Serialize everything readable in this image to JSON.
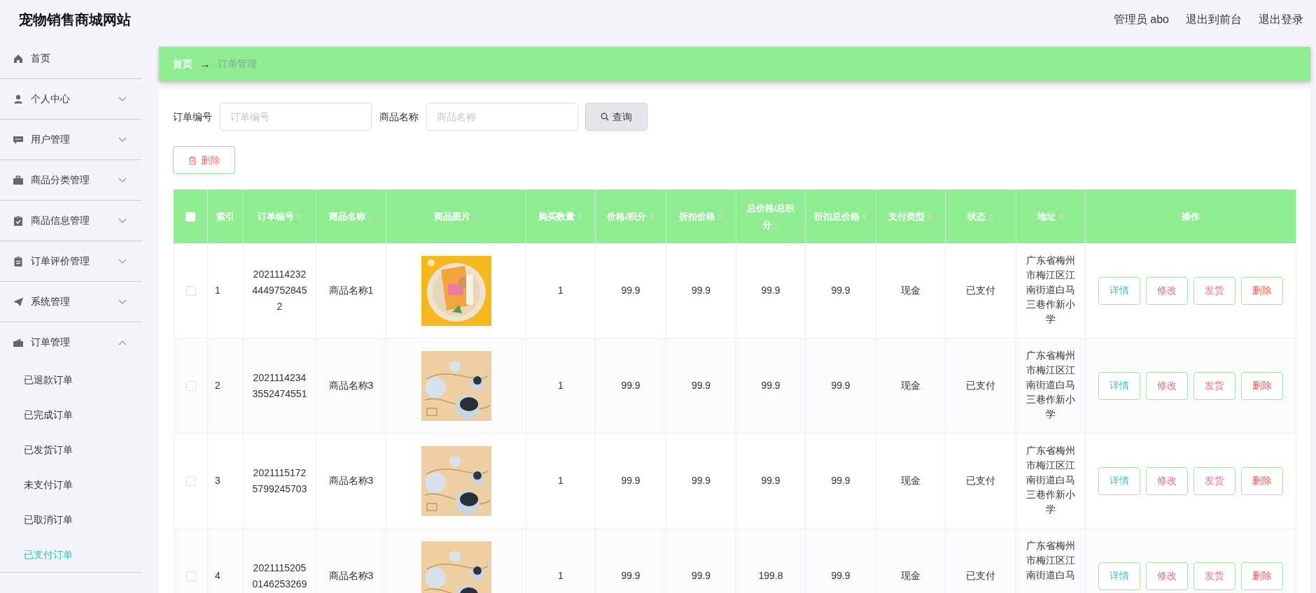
{
  "header": {
    "title": "宠物销售商城网站",
    "links": [
      "管理员 abo",
      "退出到前台",
      "退出登录"
    ]
  },
  "sidebar": {
    "items": [
      {
        "label": "首页",
        "kind": "link"
      },
      {
        "label": "个人中心",
        "kind": "submenu",
        "expanded": false
      },
      {
        "label": "用户管理",
        "kind": "submenu",
        "expanded": false
      },
      {
        "label": "商品分类管理",
        "kind": "submenu",
        "expanded": false
      },
      {
        "label": "商品信息管理",
        "kind": "submenu",
        "expanded": false
      },
      {
        "label": "订单评价管理",
        "kind": "submenu",
        "expanded": false
      },
      {
        "label": "系统管理",
        "kind": "submenu",
        "expanded": false
      },
      {
        "label": "订单管理",
        "kind": "submenu",
        "expanded": true,
        "children": [
          {
            "label": "已退款订单",
            "selected": false
          },
          {
            "label": "已完成订单",
            "selected": false
          },
          {
            "label": "已发货订单",
            "selected": false
          },
          {
            "label": "未支付订单",
            "selected": false
          },
          {
            "label": "已取消订单",
            "selected": false
          },
          {
            "label": "已支付订单",
            "selected": true
          }
        ]
      }
    ]
  },
  "breadcrumb": [
    "首页",
    "→",
    "订单管理"
  ],
  "search": {
    "fields": [
      {
        "label": "订单编号",
        "placeholder": "订单编号"
      },
      {
        "label": "商品名称",
        "placeholder": "商品名称"
      }
    ],
    "button": "查询"
  },
  "delete_button": "删除",
  "table": {
    "select_all": {
      "checked": false
    },
    "columns": [
      {
        "label": "索引",
        "sortable": false
      },
      {
        "label": "订单编号",
        "sortable": true
      },
      {
        "label": "商品名称",
        "sortable": true
      },
      {
        "label": "商品图片",
        "sortable": true
      },
      {
        "label": "购买数量",
        "sortable": true
      },
      {
        "label": "价格/积分",
        "sortable": true
      },
      {
        "label": "折扣价格",
        "sortable": true
      },
      {
        "label": "总价格/总积分",
        "sortable": true
      },
      {
        "label": "折扣总价格",
        "sortable": true
      },
      {
        "label": "支付类型",
        "sortable": true
      },
      {
        "label": "状态",
        "sortable": true
      },
      {
        "label": "地址",
        "sortable": true
      },
      {
        "label": "操作",
        "sortable": false
      }
    ],
    "rows": [
      {
        "checked": false,
        "index": "1",
        "order_no": "20211142324449752845 2",
        "product": "商品名称1",
        "qty": "1",
        "price": "99.9",
        "discount_price": "99.9",
        "total": "99.9",
        "discount_total": "99.9",
        "pay_type": "现金",
        "status": "已支付",
        "address": "广东省梅州市梅江区江南街道白马三巷作新小学",
        "actions": [
          {
            "label": "详情",
            "kind": "detail"
          },
          {
            "label": "修改",
            "kind": "edit"
          },
          {
            "label": "发货",
            "kind": "ship"
          },
          {
            "label": "删除",
            "kind": "delete"
          }
        ]
      },
      {
        "checked": false,
        "index": "2",
        "order_no": "20211142343552474551",
        "product": "商品名称3",
        "qty": "1",
        "price": "99.9",
        "discount_price": "99.9",
        "total": "99.9",
        "discount_total": "99.9",
        "pay_type": "现金",
        "status": "已支付",
        "address": "广东省梅州市梅江区江南街道白马三巷作新小学",
        "actions": [
          {
            "label": "详情",
            "kind": "detail"
          },
          {
            "label": "修改",
            "kind": "edit"
          },
          {
            "label": "发货",
            "kind": "ship"
          },
          {
            "label": "删除",
            "kind": "delete"
          }
        ]
      },
      {
        "checked": false,
        "index": "3",
        "order_no": "20211151725799245703",
        "product": "商品名称3",
        "qty": "1",
        "price": "99.9",
        "discount_price": "99.9",
        "total": "99.9",
        "discount_total": "99.9",
        "pay_type": "现金",
        "status": "已支付",
        "address": "广东省梅州市梅江区江南街道白马三巷作新小学",
        "actions": [
          {
            "label": "详情",
            "kind": "detail"
          },
          {
            "label": "修改",
            "kind": "edit"
          },
          {
            "label": "发货",
            "kind": "ship"
          },
          {
            "label": "删除",
            "kind": "delete"
          }
        ]
      },
      {
        "checked": false,
        "index": "4",
        "order_no": "20211152050146253269",
        "product": "商品名称3",
        "qty": "1",
        "price": "99.9",
        "discount_price": "99.9",
        "total": "199.8",
        "discount_total": "99.9",
        "pay_type": "现金",
        "status": "已支付",
        "address": "广东省梅州市梅江区江南街道白马",
        "actions": [
          {
            "label": "详情",
            "kind": "detail"
          },
          {
            "label": "修改",
            "kind": "edit"
          },
          {
            "label": "发货",
            "kind": "ship"
          },
          {
            "label": "删除",
            "kind": "delete"
          }
        ]
      }
    ]
  }
}
